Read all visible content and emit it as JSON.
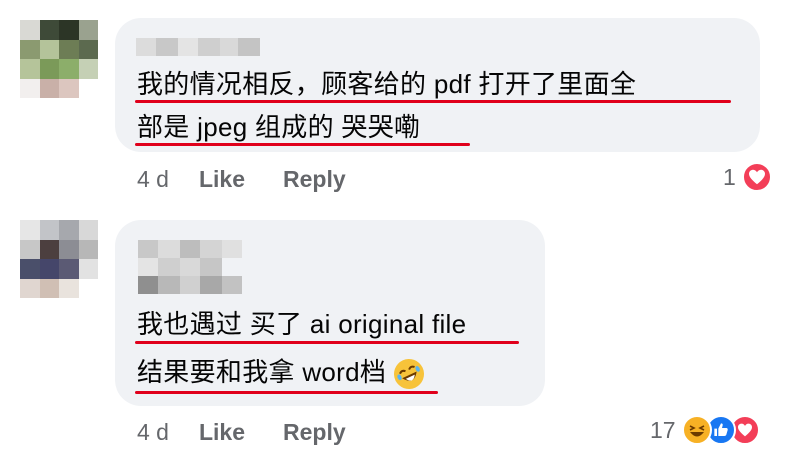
{
  "comments": [
    {
      "lines": [
        "我的情况相反，顾客给的 pdf 打开了里面全",
        "部是 jpeg 组成的 哭哭嘞"
      ],
      "time": "4 d",
      "like": "Like",
      "reply": "Reply",
      "reaction_count": "1",
      "reactions": [
        "heart-icon"
      ]
    },
    {
      "lines": [
        "我也遇过 买了 ai original file",
        "结果要和我拿 word档"
      ],
      "emoji": "rolling-on-floor-laughing-emoji",
      "time": "4 d",
      "like": "Like",
      "reply": "Reply",
      "reaction_count": "17",
      "reactions": [
        "haha-icon",
        "thumbs-up-icon",
        "heart-icon"
      ]
    }
  ],
  "colors": {
    "bubble": "#f0f2f5",
    "underline": "#e0001b",
    "muted": "#65676b"
  }
}
